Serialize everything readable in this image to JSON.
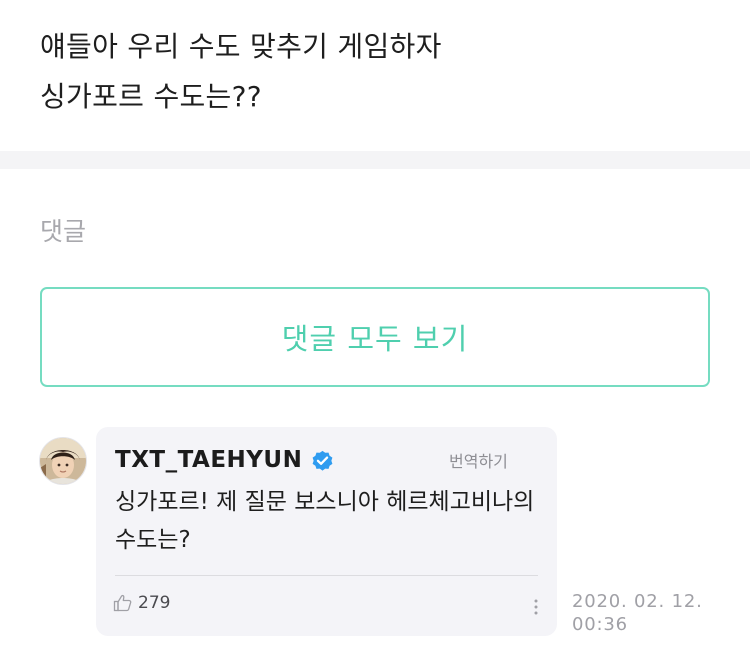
{
  "post": {
    "lines": [
      "얘들아 우리 수도 맞추기 게임하자",
      "싱가포르 수도는??"
    ]
  },
  "comments_section": {
    "heading": "댓글",
    "view_all_label": "댓글 모두 보기"
  },
  "comment": {
    "author": "TXT_TAEHYUN",
    "verified": true,
    "translate_label": "번역하기",
    "text": "싱가포르! 제 질문 보스니아 헤르체고비나의 수도는?",
    "likes": "279",
    "timestamp_date": "2020. 02. 12.",
    "timestamp_time": "00:36",
    "icons": {
      "avatar": "avatar",
      "verified": "verified-badge-icon",
      "like": "thumbs-up-icon",
      "more": "more-vertical-icon"
    }
  },
  "colors": {
    "accent": "#4fcfae",
    "accent_border": "#75dcc1",
    "verified_blue": "#2f9cf0",
    "bubble_bg": "#f4f4f8"
  }
}
